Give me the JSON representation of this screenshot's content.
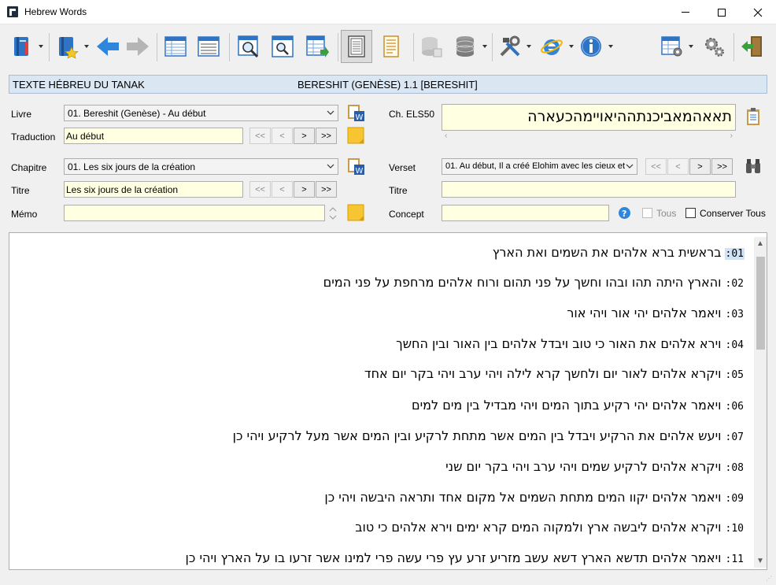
{
  "window": {
    "title": "Hebrew Words"
  },
  "header": {
    "left": "TEXTE HÉBREU DU TANAK",
    "center": "BERESHIT (GENÈSE) 1.1 [BERESHIT]"
  },
  "form": {
    "livre_label": "Livre",
    "livre_value": "01. Bereshit (Genèse) - Au début",
    "traduction_label": "Traduction",
    "traduction_value": "Au début",
    "chapitre_label": "Chapitre",
    "chapitre_value": "01. Les six jours de la création",
    "titre_label": "Titre",
    "titre_value": "Les six jours de la création",
    "memo_label": "Mémo",
    "memo_value": "",
    "els_label": "Ch. ELS50",
    "els_value": "תאאהמאביכנתההיאויימהכעארה",
    "verset_label": "Verset",
    "verset_value": "01. Au début, Il a créé Elohim avec les cieux et",
    "titre2_label": "Titre",
    "titre2_value": "",
    "concept_label": "Concept",
    "concept_value": "",
    "tous_label": "Tous",
    "conserver_label": "Conserver Tous",
    "nav": {
      "first": "<<",
      "prev": "<",
      "next": ">",
      "last": ">>"
    }
  },
  "verses": [
    {
      "num": ":01",
      "text": "בראשית ברא אלהים את השמים ואת הארץ"
    },
    {
      "num": ":02",
      "text": "והארץ היתה תהו ובהו וחשך על פני תהום ורוח אלהים מרחפת על פני המים"
    },
    {
      "num": ":03",
      "text": "ויאמר אלהים יהי אור ויהי אור"
    },
    {
      "num": ":04",
      "text": "וירא אלהים את האור כי טוב ויבדל אלהים בין האור ובין החשך"
    },
    {
      "num": ":05",
      "text": "ויקרא אלהים לאור יום ולחשך קרא לילה ויהי ערב ויהי בקר יום אחד"
    },
    {
      "num": ":06",
      "text": "ויאמר אלהים יהי רקיע בתוך המים ויהי מבדיל בין מים למים"
    },
    {
      "num": ":07",
      "text": "ויעש אלהים את הרקיע ויבדל בין המים אשר מתחת לרקיע ובין המים אשר מעל לרקיע ויהי כן"
    },
    {
      "num": ":08",
      "text": "ויקרא אלהים לרקיע שמים ויהי ערב ויהי בקר יום שני"
    },
    {
      "num": ":09",
      "text": "ויאמר אלהים יקוו המים מתחת השמים אל מקום אחד ותראה היבשה ויהי כן"
    },
    {
      "num": ":10",
      "text": "ויקרא אלהים ליבשה ארץ ולמקוה המים קרא ימים וירא אלהים כי טוב"
    },
    {
      "num": ":11",
      "text": "ויאמר אלהים תדשא הארץ דשא עשב מזריע זרע עץ פרי עשה פרי למינו אשר זרעו בו על הארץ ויהי כן"
    }
  ],
  "colors": {
    "field_bg": "#ffffe1",
    "header_bg": "#dbe6f3",
    "selection": "#cfe2f6"
  }
}
